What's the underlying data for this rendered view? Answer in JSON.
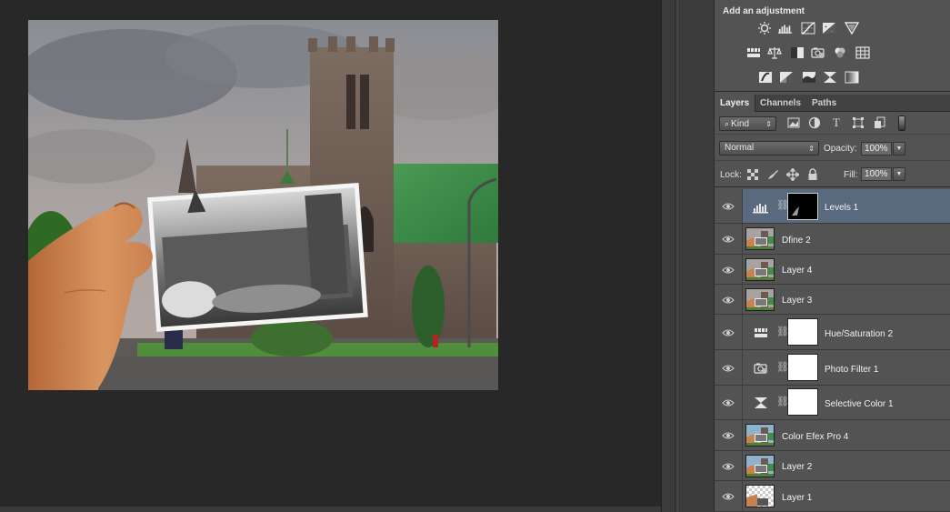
{
  "adjustments": {
    "title": "Add an adjustment",
    "row1": [
      "brightness-contrast-icon",
      "levels-icon",
      "curves-icon",
      "exposure-icon",
      "vibrance-icon"
    ],
    "row2": [
      "hue-saturation-icon",
      "color-balance-icon",
      "black-white-icon",
      "photo-filter-icon",
      "channel-mixer-icon",
      "color-lookup-icon"
    ],
    "row3": [
      "invert-icon",
      "posterize-icon",
      "threshold-icon",
      "selective-color-icon",
      "gradient-map-icon"
    ]
  },
  "tabs": [
    {
      "label": "Layers",
      "active": true
    },
    {
      "label": "Channels",
      "active": false
    },
    {
      "label": "Paths",
      "active": false
    }
  ],
  "filter": {
    "kind_label": "Kind"
  },
  "blend": {
    "mode": "Normal",
    "opacity_label": "Opacity:",
    "opacity_value": "100%"
  },
  "lock": {
    "label": "Lock:",
    "fill_label": "Fill:",
    "fill_value": "100%"
  },
  "layers": [
    {
      "name": "Levels 1",
      "type": "adjustment",
      "adj_icon": "levels-icon",
      "mask": "black",
      "selected": true
    },
    {
      "name": "Dfine 2",
      "type": "pixel"
    },
    {
      "name": "Layer 4",
      "type": "pixel"
    },
    {
      "name": "Layer 3",
      "type": "pixel"
    },
    {
      "name": "Hue/Saturation 2",
      "type": "adjustment",
      "adj_icon": "hue-saturation-icon",
      "mask": "white"
    },
    {
      "name": "Photo Filter 1",
      "type": "adjustment",
      "adj_icon": "photo-filter-icon",
      "mask": "white"
    },
    {
      "name": "Selective Color 1",
      "type": "adjustment",
      "adj_icon": "selective-color-icon",
      "mask": "white"
    },
    {
      "name": "Color Efex Pro 4",
      "type": "pixel"
    },
    {
      "name": "Layer 2",
      "type": "pixel"
    },
    {
      "name": "Layer 1",
      "type": "transparent"
    }
  ],
  "colors": {
    "selected_layer": "#59697e",
    "panel_bg": "#535353",
    "canvas_bg": "#282828",
    "roof_green": "#3f8f4a"
  }
}
